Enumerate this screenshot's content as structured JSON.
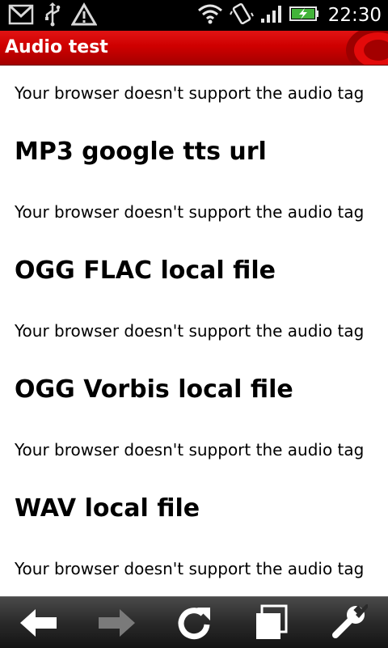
{
  "status_bar": {
    "left_icons": [
      "gmail-icon",
      "usb-icon",
      "warning-icon"
    ],
    "right_icons": [
      "wifi-icon",
      "vibrate-icon",
      "signal-icon",
      "battery-charging-icon"
    ],
    "time": "22:30"
  },
  "title_bar": {
    "title": "Audio test",
    "color": "#cc0000"
  },
  "content": {
    "items": [
      {
        "type": "message",
        "text": "Your browser doesn't support the audio tag"
      },
      {
        "type": "heading",
        "text": "MP3 google tts url"
      },
      {
        "type": "message",
        "text": "Your browser doesn't support the audio tag"
      },
      {
        "type": "heading",
        "text": "OGG FLAC local file"
      },
      {
        "type": "message",
        "text": "Your browser doesn't support the audio tag"
      },
      {
        "type": "heading",
        "text": "OGG Vorbis local file"
      },
      {
        "type": "message",
        "text": "Your browser doesn't support the audio tag"
      },
      {
        "type": "heading",
        "text": "WAV local file"
      },
      {
        "type": "message",
        "text": "Your browser doesn't support the audio tag"
      }
    ]
  },
  "toolbar": {
    "buttons": [
      {
        "icon": "back-arrow-icon",
        "enabled": true
      },
      {
        "icon": "forward-arrow-icon",
        "enabled": false
      },
      {
        "icon": "refresh-icon",
        "enabled": true
      },
      {
        "icon": "windows-icon",
        "enabled": true
      },
      {
        "icon": "settings-wrench-icon",
        "enabled": true
      }
    ]
  }
}
